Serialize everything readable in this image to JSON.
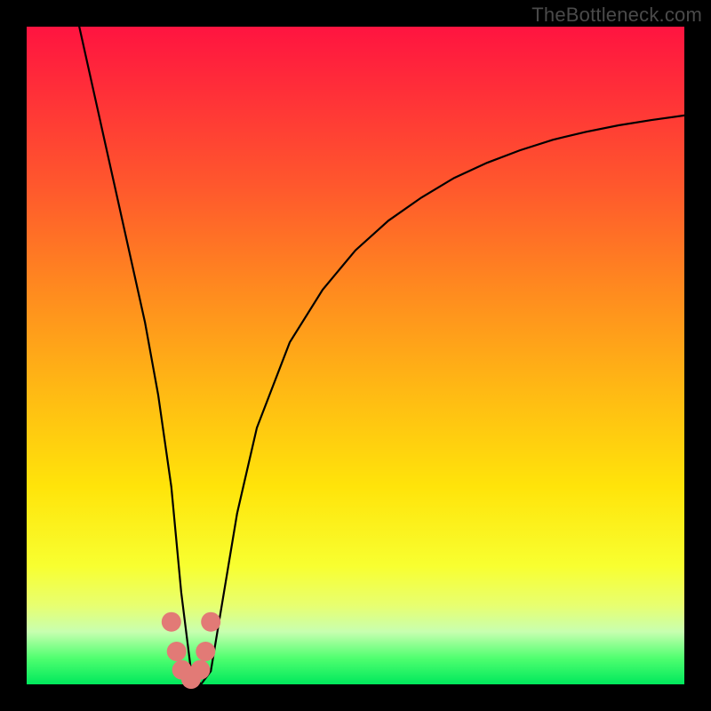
{
  "watermark": "TheBottleneck.com",
  "chart_data": {
    "type": "line",
    "title": "",
    "xlabel": "",
    "ylabel": "",
    "xlim": [
      0,
      100
    ],
    "ylim": [
      0,
      100
    ],
    "curve": {
      "x": [
        8,
        10,
        12,
        14,
        16,
        18,
        20,
        22,
        23.5,
        25,
        26.5,
        28,
        30,
        32,
        35,
        40,
        45,
        50,
        55,
        60,
        65,
        70,
        75,
        80,
        85,
        90,
        95,
        100
      ],
      "y": [
        100,
        91,
        82,
        73,
        64,
        55,
        44,
        30,
        14,
        2,
        0,
        2,
        14,
        26,
        39,
        52,
        60,
        66,
        70.5,
        74,
        77,
        79.3,
        81.2,
        82.8,
        84,
        85,
        85.8,
        86.5
      ]
    },
    "markers": {
      "x": [
        22.0,
        22.8,
        23.6,
        25.0,
        26.4,
        27.2,
        28.0
      ],
      "y": [
        9.5,
        5.0,
        2.2,
        0.8,
        2.2,
        5.0,
        9.5
      ]
    },
    "gradient_note": "background encodes bottleneck severity: red (high) at top to green (low) at bottom"
  }
}
